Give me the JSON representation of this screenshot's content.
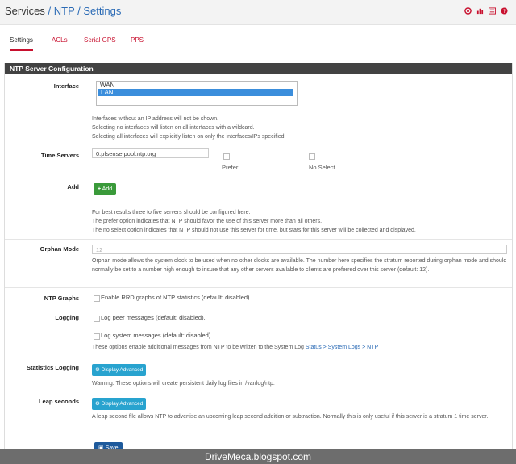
{
  "breadcrumb": {
    "root": "Services",
    "sep": "/",
    "section": "NTP",
    "page": "Settings"
  },
  "header_icons": [
    "stop-icon",
    "chart-icon",
    "list-icon",
    "help-icon"
  ],
  "tabs": [
    {
      "label": "Settings",
      "active": true
    },
    {
      "label": "ACLs",
      "active": false
    },
    {
      "label": "Serial GPS",
      "active": false
    },
    {
      "label": "PPS",
      "active": false
    }
  ],
  "panel": {
    "title": "NTP Server Configuration"
  },
  "interface": {
    "label": "Interface",
    "options": [
      {
        "label": "WAN",
        "selected": false
      },
      {
        "label": "LAN",
        "selected": true
      }
    ],
    "help": [
      "Interfaces without an IP address will not be shown.",
      "Selecting no interfaces will listen on all interfaces with a wildcard.",
      "Selecting all interfaces will explicitly listen on only the interfaces/IPs specified."
    ]
  },
  "time_servers": {
    "label": "Time Servers",
    "value": "0.pfsense.pool.ntp.org",
    "prefer_label": "Prefer",
    "noselect_label": "No Select"
  },
  "add": {
    "label": "Add",
    "button": "Add",
    "help": [
      "For best results three to five servers should be configured here.",
      "The prefer option indicates that NTP should favor the use of this server more than all others.",
      "The no select option indicates that NTP should not use this server for time, but stats for this server will be collected and displayed."
    ]
  },
  "orphan": {
    "label": "Orphan Mode",
    "placeholder": "12",
    "help": "Orphan mode allows the system clock to be used when no other clocks are available. The number here specifies the stratum reported during orphan mode and should normally be set to a number high enough to insure that any other servers available to clients are preferred over this server (default: 12)."
  },
  "graphs": {
    "label": "NTP Graphs",
    "checkbox": "Enable RRD graphs of NTP statistics (default: disabled)."
  },
  "logging": {
    "label": "Logging",
    "peer": "Log peer messages (default: disabled).",
    "system": "Log system messages (default: disabled).",
    "help_prefix": "These options enable additional messages from NTP to be written to the System Log ",
    "help_link": "Status > System Logs > NTP"
  },
  "stats": {
    "label": "Statistics Logging",
    "button": "Display Advanced",
    "help": "Warning: These options will create persistent daily log files in /var/log/ntp."
  },
  "leap": {
    "label": "Leap seconds",
    "button": "Display Advanced",
    "help": "A leap second file allows NTP to advertise an upcoming leap second addition or subtraction. Normally this is only useful if this server is a stratum 1 time server."
  },
  "save": "Save",
  "watermark": "DriveMeca.blogspot.com",
  "colors": {
    "brand_red": "#c8102e",
    "link_blue": "#2a6ab5",
    "add_green": "#3a9a3a",
    "advanced_blue": "#28a3cf"
  }
}
